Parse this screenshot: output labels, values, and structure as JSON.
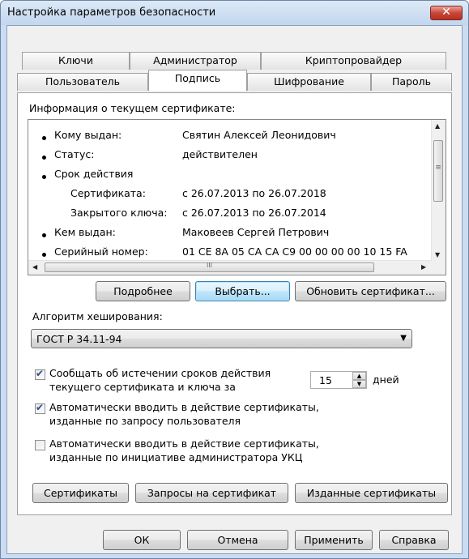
{
  "window": {
    "title": "Настройка параметров безопасности",
    "close_glyph": "✕"
  },
  "tabs": {
    "row1": [
      "Ключи",
      "Администратор",
      "Криптопровайдер"
    ],
    "row2": [
      "Пользователь",
      "Подпись",
      "Шифрование",
      "Пароль"
    ],
    "selected": "Подпись"
  },
  "cert_info": {
    "heading": "Информация о текущем сертификате:",
    "rows": [
      {
        "bullet": true,
        "label": "Кому выдан:",
        "value": "Святин Алексей Леонидович"
      },
      {
        "bullet": true,
        "label": "Статус:",
        "value": "действителен"
      },
      {
        "bullet": true,
        "label": "Срок действия",
        "value": ""
      },
      {
        "bullet": false,
        "label": "Сертификата:",
        "value": "с 26.07.2013 по 26.07.2018"
      },
      {
        "bullet": false,
        "label": "Закрытого ключа:",
        "value": "с 26.07.2013 по 26.07.2014"
      },
      {
        "bullet": true,
        "label": "Кем выдан:",
        "value": "Маковеев Сергей Петрович"
      },
      {
        "bullet": true,
        "label": "Серийный номер:",
        "value": "01 CE 8A 05 CA CA C9 00 00 00 00 10 15 FA"
      }
    ],
    "scrollbar_thumb_glyph_v": "≡",
    "scrollbar_thumb_glyph_h": "III"
  },
  "buttons": {
    "details": "Подробнее",
    "select": "Выбрать...",
    "refresh": "Обновить сертификат..."
  },
  "hash": {
    "label": "Алгоритм хеширования:",
    "value": "ГОСТ Р 34.11-94"
  },
  "options": {
    "expiry_notify": {
      "checked": true,
      "line1": "Сообщать об истечении сроков действия",
      "line2": "текущего сертификата и ключа за",
      "days_value": "15",
      "days_unit": "дней"
    },
    "auto_user": {
      "checked": true,
      "line1": "Автоматически вводить в действие сертификаты,",
      "line2": "изданные по запросу пользователя"
    },
    "auto_admin": {
      "checked": false,
      "line1": "Автоматически вводить в действие сертификаты,",
      "line2": "изданные по инициативе администратора УКЦ"
    }
  },
  "bottom_buttons": {
    "certs": "Сертификаты",
    "requests": "Запросы на сертификат",
    "issued": "Изданные сертификаты"
  },
  "dialog_buttons": {
    "ok": "ОК",
    "cancel": "Отмена",
    "apply": "Применить",
    "help": "Справка"
  }
}
